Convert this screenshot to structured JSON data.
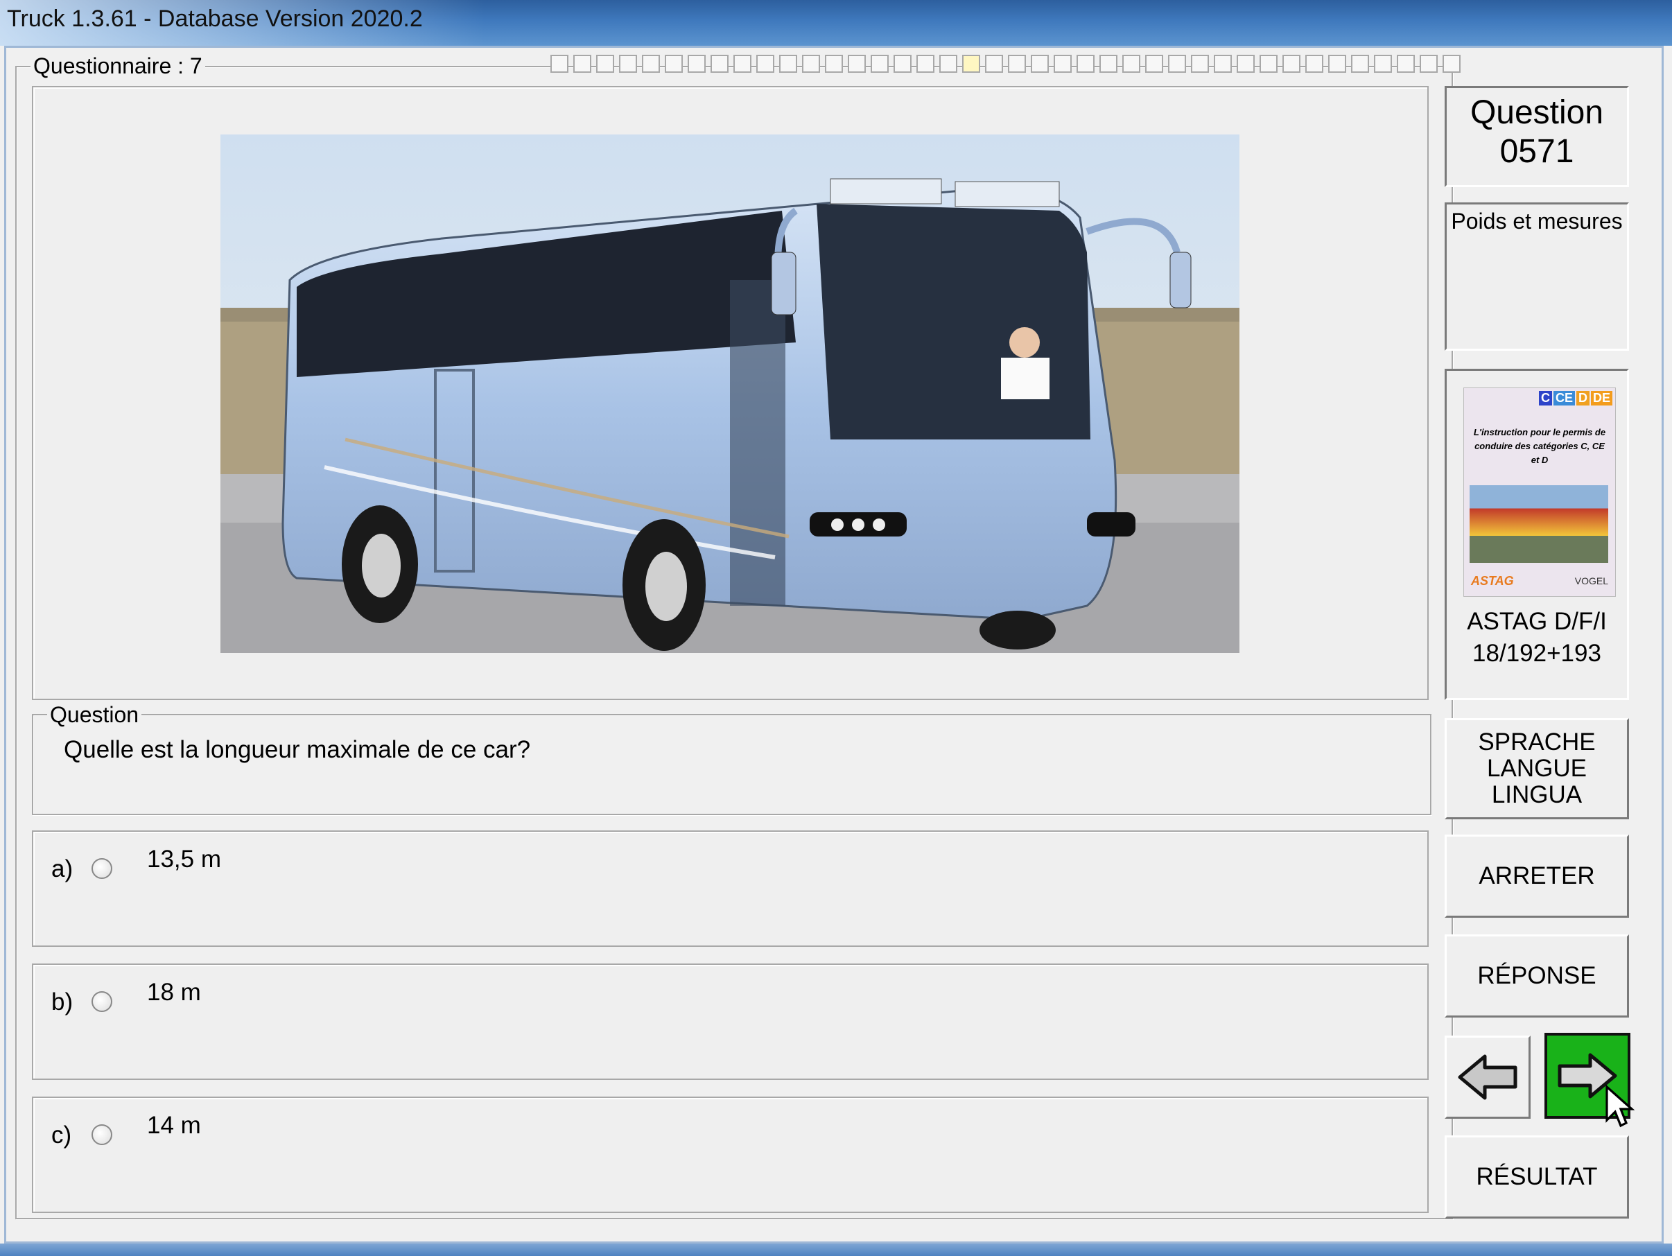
{
  "window": {
    "title": "Truck 1.3.61 - Database Version 2020.2"
  },
  "questionnaire": {
    "label": "Questionnaire : 7"
  },
  "progress": {
    "total": 40,
    "current": 18
  },
  "question_panel": {
    "legend": "Question",
    "text": "Quelle est la longueur maximale de ce car?"
  },
  "answers": [
    {
      "letter": "a)",
      "text": "13,5 m"
    },
    {
      "letter": "b)",
      "text": "18 m"
    },
    {
      "letter": "c)",
      "text": "14 m"
    }
  ],
  "sidebar": {
    "question_label": "Question",
    "question_number": "0571",
    "category": "Poids et mesures",
    "book": {
      "badges": [
        "C",
        "CE",
        "D",
        "DE"
      ],
      "cover_text": "L'instruction pour le permis de conduire des catégories C, CE et D",
      "publishers": [
        "ASTAG",
        "VOGEL"
      ],
      "source_line1": "ASTAG D/F/I",
      "source_line2": "18/192+193"
    },
    "buttons": {
      "language_1": "SPRACHE",
      "language_2": "LANGUE",
      "language_3": "LINGUA",
      "stop": "ARRETER",
      "answer": "RÉPONSE",
      "result": "RÉSULTAT"
    }
  },
  "colors": {
    "next_button": "#19b219",
    "title_bar": "#3f79bd",
    "bus_body": "#a9c3e6"
  }
}
